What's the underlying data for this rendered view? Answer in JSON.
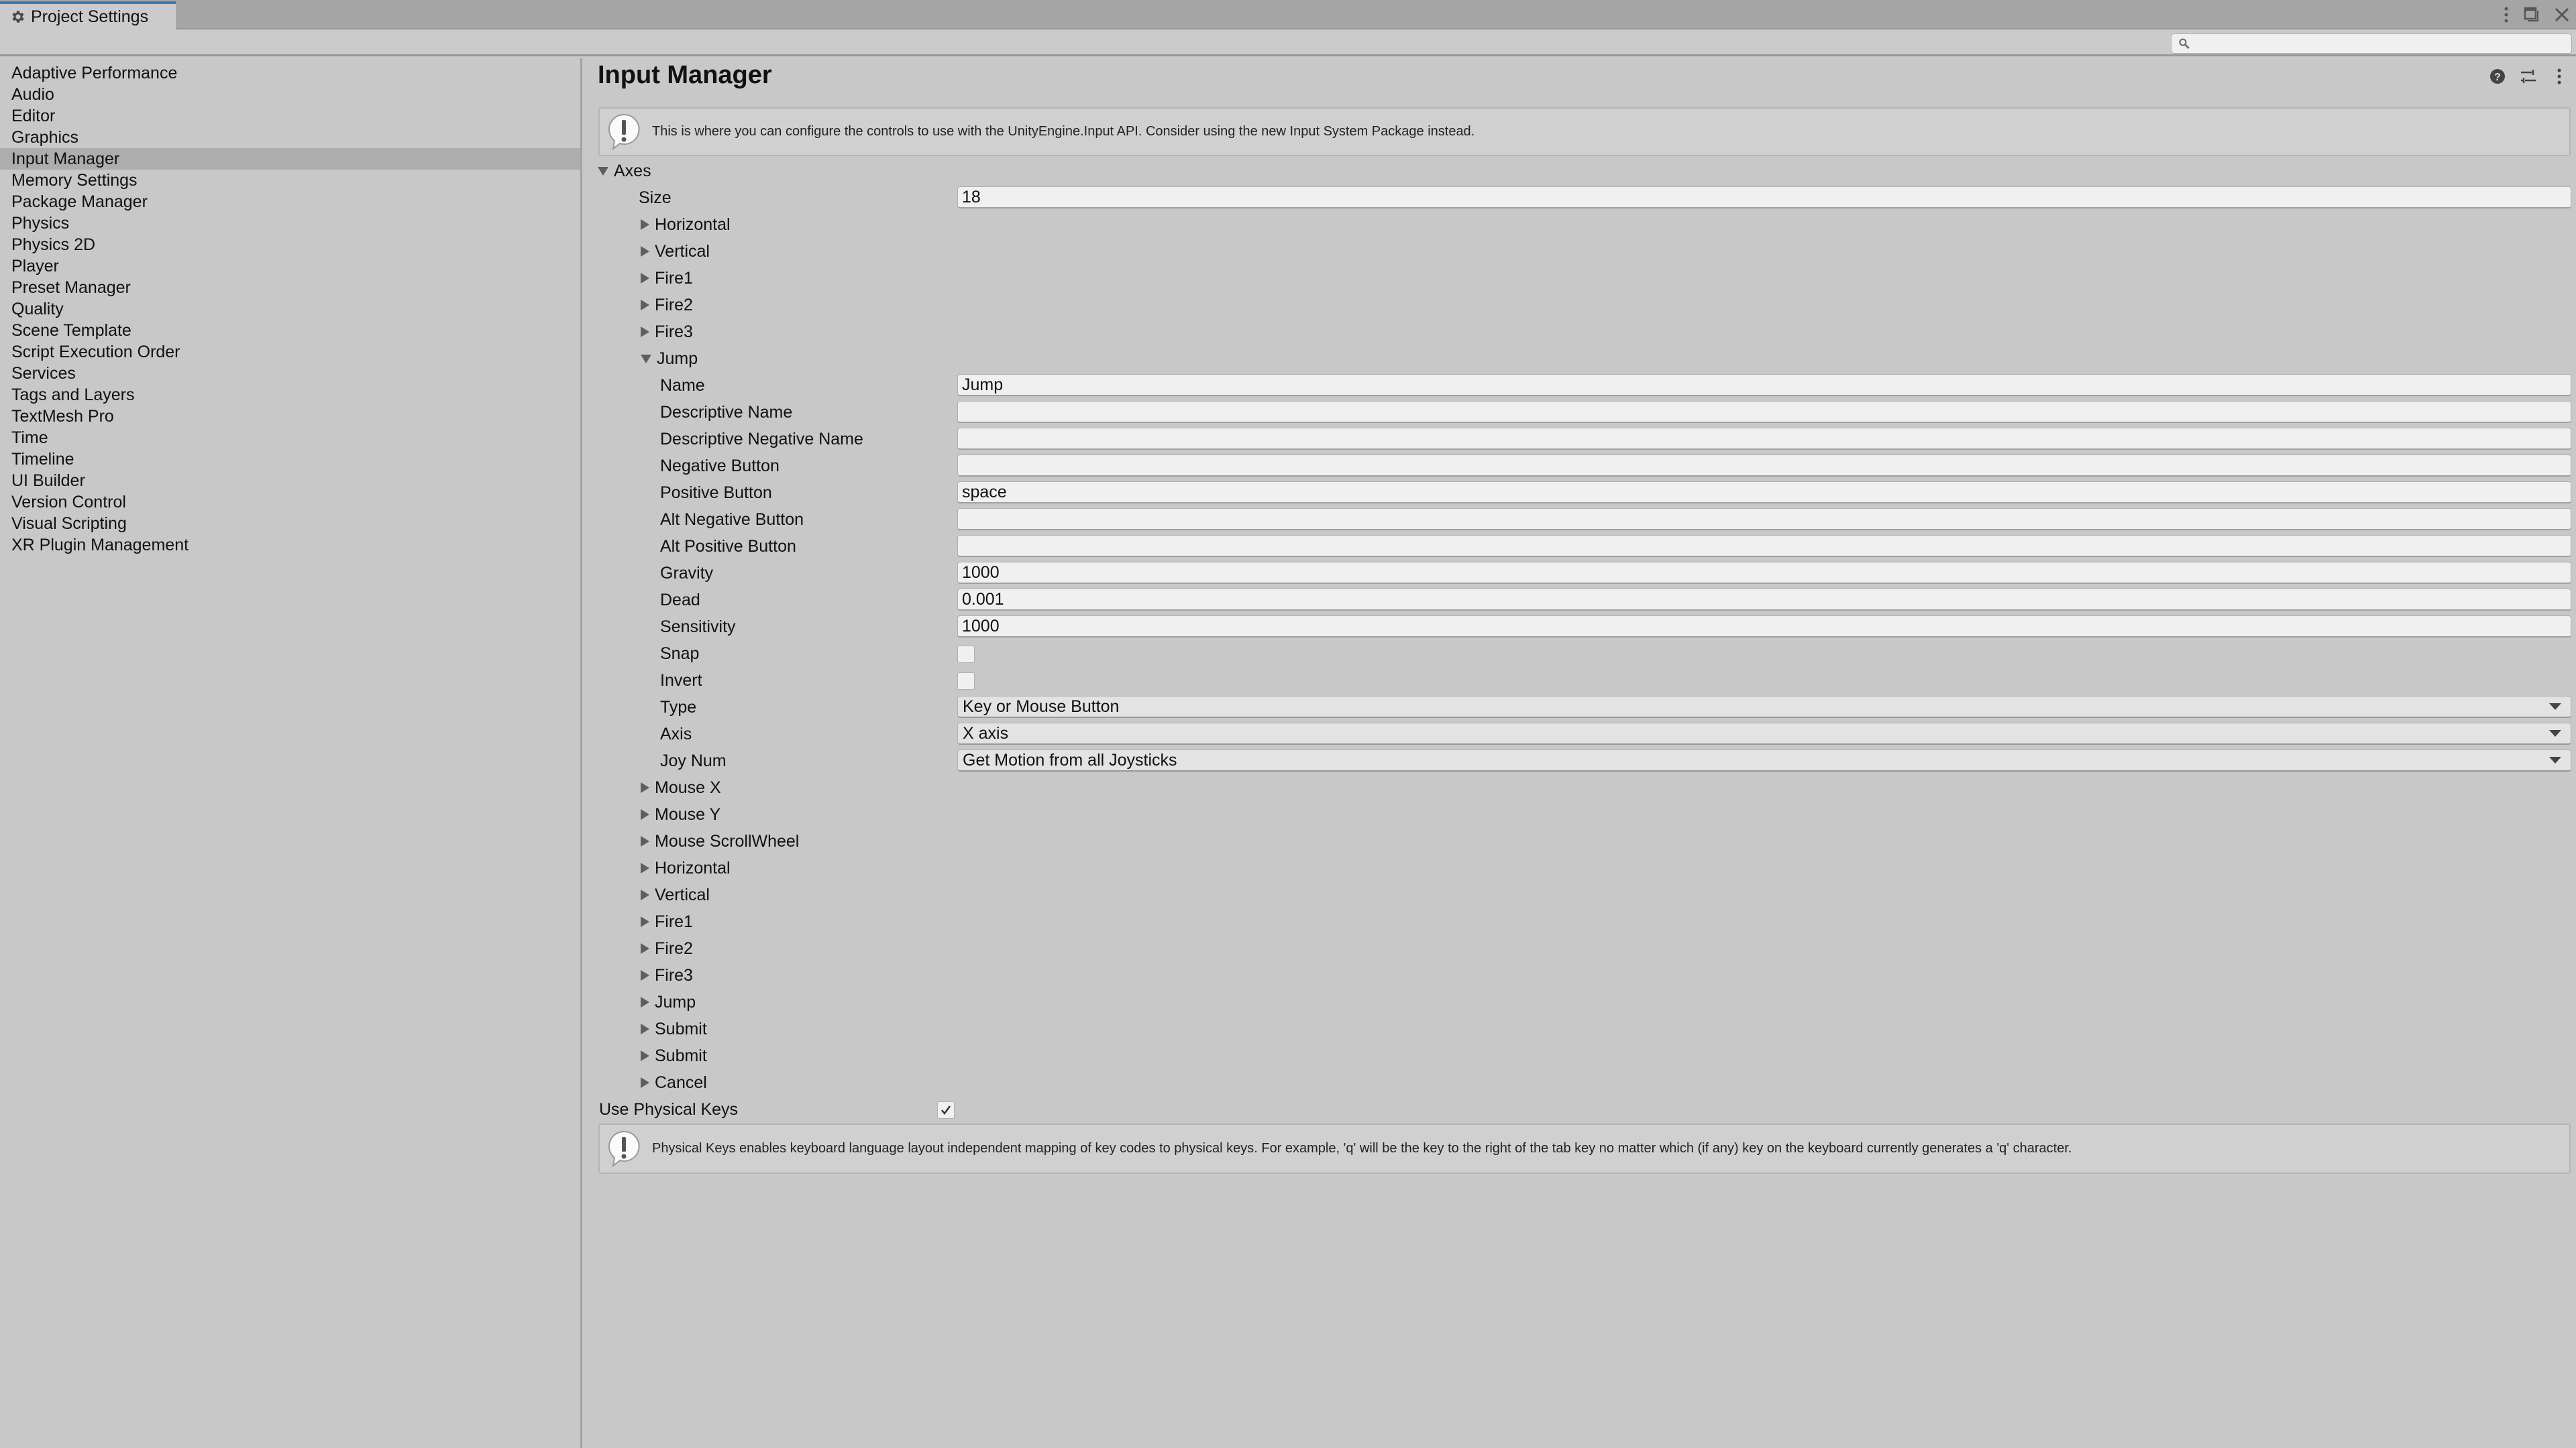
{
  "window": {
    "tab_title": "Project Settings",
    "controls": [
      "more-icon",
      "maximize-icon",
      "close-icon"
    ]
  },
  "search": {
    "placeholder": "",
    "value": ""
  },
  "sidebar": {
    "selected": "Input Manager",
    "items": [
      {
        "label": "Adaptive Performance"
      },
      {
        "label": "Audio"
      },
      {
        "label": "Editor"
      },
      {
        "label": "Graphics"
      },
      {
        "label": "Input Manager"
      },
      {
        "label": "Memory Settings"
      },
      {
        "label": "Package Manager"
      },
      {
        "label": "Physics"
      },
      {
        "label": "Physics 2D"
      },
      {
        "label": "Player"
      },
      {
        "label": "Preset Manager"
      },
      {
        "label": "Quality"
      },
      {
        "label": "Scene Template"
      },
      {
        "label": "Script Execution Order"
      },
      {
        "label": "Services"
      },
      {
        "label": "Tags and Layers"
      },
      {
        "label": "TextMesh Pro"
      },
      {
        "label": "Time"
      },
      {
        "label": "Timeline"
      },
      {
        "label": "UI Builder"
      },
      {
        "label": "Version Control"
      },
      {
        "label": "Visual Scripting"
      },
      {
        "label": "XR Plugin Management"
      }
    ]
  },
  "main": {
    "title": "Input Manager",
    "header_icons": [
      "help-icon",
      "presets-icon",
      "more-icon"
    ],
    "info_message": "This is where you can configure the controls to use with the UnityEngine.Input API. Consider using the new Input System Package instead.",
    "axes": {
      "label": "Axes",
      "expanded": true,
      "size_label": "Size",
      "size_value": "18",
      "entries_before": [
        {
          "label": "Horizontal",
          "expanded": false
        },
        {
          "label": "Vertical",
          "expanded": false
        },
        {
          "label": "Fire1",
          "expanded": false
        },
        {
          "label": "Fire2",
          "expanded": false
        },
        {
          "label": "Fire3",
          "expanded": false
        }
      ],
      "expanded_entry": {
        "label": "Jump",
        "expanded": true,
        "fields": [
          {
            "label": "Name",
            "value": "Jump"
          },
          {
            "label": "Descriptive Name",
            "value": ""
          },
          {
            "label": "Descriptive Negative Name",
            "value": ""
          },
          {
            "label": "Negative Button",
            "value": ""
          },
          {
            "label": "Positive Button",
            "value": "space"
          },
          {
            "label": "Alt Negative Button",
            "value": ""
          },
          {
            "label": "Alt Positive Button",
            "value": ""
          },
          {
            "label": "Gravity",
            "value": "1000"
          },
          {
            "label": "Dead",
            "value": "0.001"
          },
          {
            "label": "Sensitivity",
            "value": "1000"
          }
        ],
        "snap": {
          "label": "Snap",
          "checked": false
        },
        "invert": {
          "label": "Invert",
          "checked": false
        },
        "type": {
          "label": "Type",
          "value": "Key or Mouse Button"
        },
        "axis": {
          "label": "Axis",
          "value": "X axis"
        },
        "joy_num": {
          "label": "Joy Num",
          "value": "Get Motion from all Joysticks"
        }
      },
      "entries_after": [
        {
          "label": "Mouse X",
          "expanded": false
        },
        {
          "label": "Mouse Y",
          "expanded": false
        },
        {
          "label": "Mouse ScrollWheel",
          "expanded": false
        },
        {
          "label": "Horizontal",
          "expanded": false
        },
        {
          "label": "Vertical",
          "expanded": false
        },
        {
          "label": "Fire1",
          "expanded": false
        },
        {
          "label": "Fire2",
          "expanded": false
        },
        {
          "label": "Fire3",
          "expanded": false
        },
        {
          "label": "Jump",
          "expanded": false
        },
        {
          "label": "Submit",
          "expanded": false
        },
        {
          "label": "Submit",
          "expanded": false
        },
        {
          "label": "Cancel",
          "expanded": false
        }
      ]
    },
    "use_physical_keys": {
      "label": "Use Physical Keys",
      "checked": true
    },
    "physical_keys_message": "Physical Keys enables keyboard language layout independent mapping of key codes to physical keys. For example, 'q' will be the key to the right of the tab key no matter which (if any) key on the keyboard currently generates a 'q' character."
  },
  "colors": {
    "background": "#c8c8c8",
    "titlebar": "#a5a5a5",
    "selected_item": "#adadad",
    "field_bg": "#f0f0f0",
    "tab_accent": "#3a79bb"
  }
}
